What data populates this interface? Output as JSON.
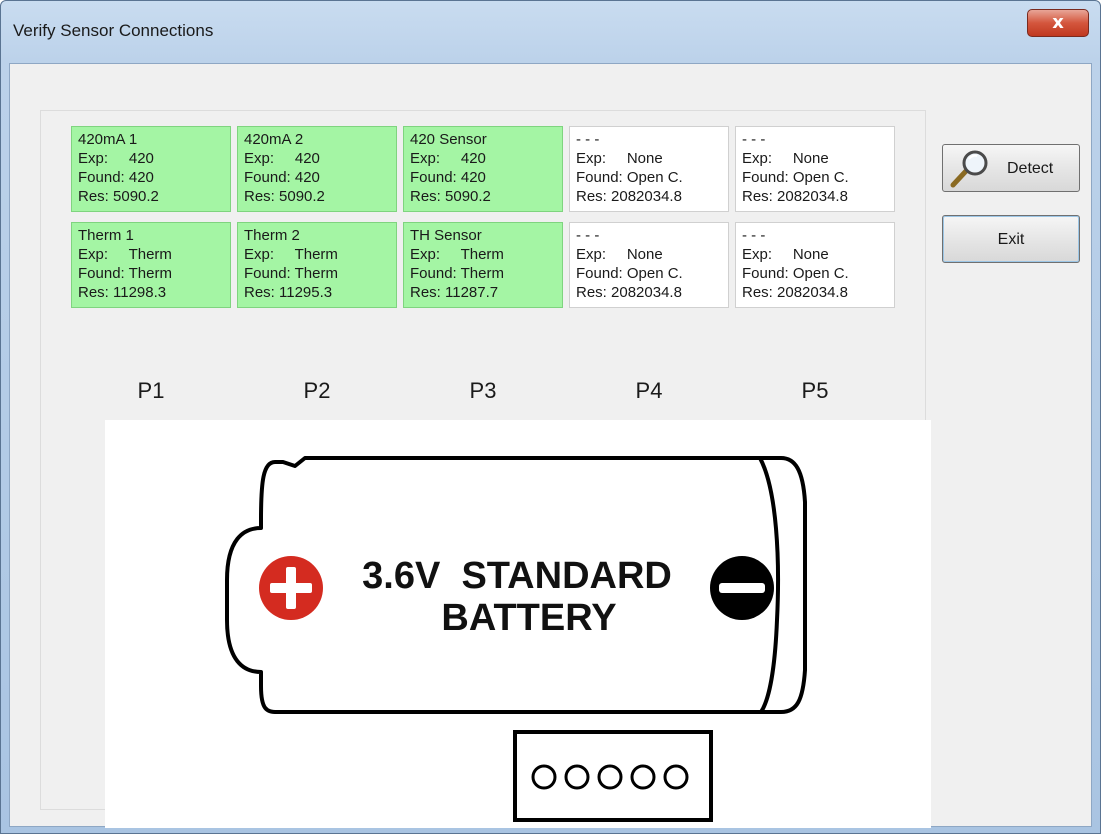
{
  "window": {
    "title": "Verify Sensor Connections",
    "close_glyph": "x"
  },
  "ports": [
    {
      "label": "P1",
      "top": {
        "name": "420mA 1",
        "exp": "Exp:     420",
        "found": "Found: 420",
        "res": "Res: 5090.2",
        "status": "ok"
      },
      "bottom": {
        "name": "Therm 1",
        "exp": "Exp:     Therm",
        "found": "Found: Therm",
        "res": "Res: 11298.3",
        "status": "ok"
      }
    },
    {
      "label": "P2",
      "top": {
        "name": "420mA 2",
        "exp": "Exp:     420",
        "found": "Found: 420",
        "res": "Res: 5090.2",
        "status": "ok"
      },
      "bottom": {
        "name": "Therm 2",
        "exp": "Exp:     Therm",
        "found": "Found: Therm",
        "res": "Res: 11295.3",
        "status": "ok"
      }
    },
    {
      "label": "P3",
      "top": {
        "name": "420 Sensor",
        "exp": "Exp:     420",
        "found": "Found: 420",
        "res": "Res: 5090.2",
        "status": "ok"
      },
      "bottom": {
        "name": "TH Sensor",
        "exp": "Exp:     Therm",
        "found": "Found: Therm",
        "res": "Res: 11287.7",
        "status": "ok"
      }
    },
    {
      "label": "P4",
      "top": {
        "name": "- - -",
        "exp": "Exp:     None",
        "found": "Found: Open C.",
        "res": "Res: 2082034.8",
        "status": "none"
      },
      "bottom": {
        "name": "- - -",
        "exp": "Exp:     None",
        "found": "Found: Open C.",
        "res": "Res: 2082034.8",
        "status": "none"
      }
    },
    {
      "label": "P5",
      "top": {
        "name": "- - -",
        "exp": "Exp:     None",
        "found": "Found: Open C.",
        "res": "Res: 2082034.8",
        "status": "none"
      },
      "bottom": {
        "name": "- - -",
        "exp": "Exp:     None",
        "found": "Found: Open C.",
        "res": "Res: 2082034.8",
        "status": "none"
      }
    }
  ],
  "battery": {
    "line1": "3.6V  STANDARD",
    "line2": "BATTERY",
    "plus_icon": "plus-terminal-icon",
    "minus_icon": "minus-terminal-icon"
  },
  "buttons": {
    "detect": "Detect",
    "exit": "Exit"
  },
  "colors": {
    "ok_cell": "#a4f5a4",
    "none_cell": "#ffffff",
    "plus_red": "#d42b20",
    "minus_black": "#000000"
  }
}
